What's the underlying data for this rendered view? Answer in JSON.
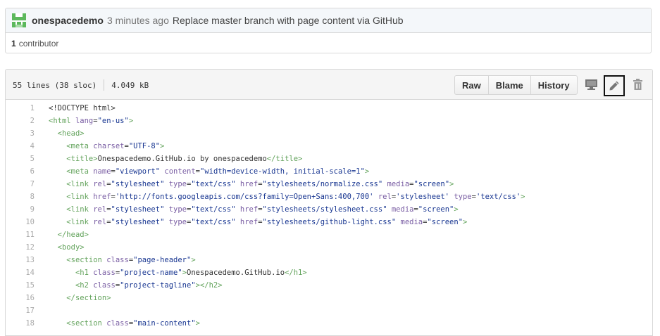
{
  "commit": {
    "author": "onespacedemo",
    "time_ago": "3 minutes ago",
    "message": "Replace master branch with page content via GitHub",
    "contributors_count": "1",
    "contributors_label": "contributor"
  },
  "file": {
    "lines_info": "55 lines (38 sloc)",
    "size": "4.049 kB",
    "buttons": {
      "raw": "Raw",
      "blame": "Blame",
      "history": "History"
    },
    "icons": [
      "desktop-icon",
      "pencil-icon",
      "trash-icon"
    ]
  },
  "colors": {
    "tag": "#63a35c",
    "attr": "#795da3",
    "string": "#183691",
    "avatar": "#5cb85c"
  },
  "code_lines": [
    {
      "n": "1",
      "tokens": [
        [
          "txt",
          "<!DOCTYPE html>"
        ]
      ]
    },
    {
      "n": "2",
      "tokens": [
        [
          "tag",
          "<html "
        ],
        [
          "attr",
          "lang"
        ],
        [
          "txt",
          "="
        ],
        [
          "str",
          "\"en-us\""
        ],
        [
          "tag",
          ">"
        ]
      ]
    },
    {
      "n": "3",
      "tokens": [
        [
          "txt",
          "  "
        ],
        [
          "tag",
          "<head>"
        ]
      ]
    },
    {
      "n": "4",
      "tokens": [
        [
          "txt",
          "    "
        ],
        [
          "tag",
          "<meta "
        ],
        [
          "attr",
          "charset"
        ],
        [
          "txt",
          "="
        ],
        [
          "str",
          "\"UTF-8\""
        ],
        [
          "tag",
          ">"
        ]
      ]
    },
    {
      "n": "5",
      "tokens": [
        [
          "txt",
          "    "
        ],
        [
          "tag",
          "<title>"
        ],
        [
          "txt",
          "Onespacedemo.GitHub.io by onespacedemo"
        ],
        [
          "tag",
          "</title>"
        ]
      ]
    },
    {
      "n": "6",
      "tokens": [
        [
          "txt",
          "    "
        ],
        [
          "tag",
          "<meta "
        ],
        [
          "attr",
          "name"
        ],
        [
          "txt",
          "="
        ],
        [
          "str",
          "\"viewport\""
        ],
        [
          "txt",
          " "
        ],
        [
          "attr",
          "content"
        ],
        [
          "txt",
          "="
        ],
        [
          "str",
          "\"width=device-width, initial-scale=1\""
        ],
        [
          "tag",
          ">"
        ]
      ]
    },
    {
      "n": "7",
      "tokens": [
        [
          "txt",
          "    "
        ],
        [
          "tag",
          "<link "
        ],
        [
          "attr",
          "rel"
        ],
        [
          "txt",
          "="
        ],
        [
          "str",
          "\"stylesheet\""
        ],
        [
          "txt",
          " "
        ],
        [
          "attr",
          "type"
        ],
        [
          "txt",
          "="
        ],
        [
          "str",
          "\"text/css\""
        ],
        [
          "txt",
          " "
        ],
        [
          "attr",
          "href"
        ],
        [
          "txt",
          "="
        ],
        [
          "str",
          "\"stylesheets/normalize.css\""
        ],
        [
          "txt",
          " "
        ],
        [
          "attr",
          "media"
        ],
        [
          "txt",
          "="
        ],
        [
          "str",
          "\"screen\""
        ],
        [
          "tag",
          ">"
        ]
      ]
    },
    {
      "n": "8",
      "tokens": [
        [
          "txt",
          "    "
        ],
        [
          "tag",
          "<link "
        ],
        [
          "attr",
          "href"
        ],
        [
          "txt",
          "="
        ],
        [
          "str",
          "'http://fonts.googleapis.com/css?family=Open+Sans:400,700'"
        ],
        [
          "txt",
          " "
        ],
        [
          "attr",
          "rel"
        ],
        [
          "txt",
          "="
        ],
        [
          "str",
          "'stylesheet'"
        ],
        [
          "txt",
          " "
        ],
        [
          "attr",
          "type"
        ],
        [
          "txt",
          "="
        ],
        [
          "str",
          "'text/css'"
        ],
        [
          "tag",
          ">"
        ]
      ]
    },
    {
      "n": "9",
      "tokens": [
        [
          "txt",
          "    "
        ],
        [
          "tag",
          "<link "
        ],
        [
          "attr",
          "rel"
        ],
        [
          "txt",
          "="
        ],
        [
          "str",
          "\"stylesheet\""
        ],
        [
          "txt",
          " "
        ],
        [
          "attr",
          "type"
        ],
        [
          "txt",
          "="
        ],
        [
          "str",
          "\"text/css\""
        ],
        [
          "txt",
          " "
        ],
        [
          "attr",
          "href"
        ],
        [
          "txt",
          "="
        ],
        [
          "str",
          "\"stylesheets/stylesheet.css\""
        ],
        [
          "txt",
          " "
        ],
        [
          "attr",
          "media"
        ],
        [
          "txt",
          "="
        ],
        [
          "str",
          "\"screen\""
        ],
        [
          "tag",
          ">"
        ]
      ]
    },
    {
      "n": "10",
      "tokens": [
        [
          "txt",
          "    "
        ],
        [
          "tag",
          "<link "
        ],
        [
          "attr",
          "rel"
        ],
        [
          "txt",
          "="
        ],
        [
          "str",
          "\"stylesheet\""
        ],
        [
          "txt",
          " "
        ],
        [
          "attr",
          "type"
        ],
        [
          "txt",
          "="
        ],
        [
          "str",
          "\"text/css\""
        ],
        [
          "txt",
          " "
        ],
        [
          "attr",
          "href"
        ],
        [
          "txt",
          "="
        ],
        [
          "str",
          "\"stylesheets/github-light.css\""
        ],
        [
          "txt",
          " "
        ],
        [
          "attr",
          "media"
        ],
        [
          "txt",
          "="
        ],
        [
          "str",
          "\"screen\""
        ],
        [
          "tag",
          ">"
        ]
      ]
    },
    {
      "n": "11",
      "tokens": [
        [
          "txt",
          "  "
        ],
        [
          "tag",
          "</head>"
        ]
      ]
    },
    {
      "n": "12",
      "tokens": [
        [
          "txt",
          "  "
        ],
        [
          "tag",
          "<body>"
        ]
      ]
    },
    {
      "n": "13",
      "tokens": [
        [
          "txt",
          "    "
        ],
        [
          "tag",
          "<section "
        ],
        [
          "attr",
          "class"
        ],
        [
          "txt",
          "="
        ],
        [
          "str",
          "\"page-header\""
        ],
        [
          "tag",
          ">"
        ]
      ]
    },
    {
      "n": "14",
      "tokens": [
        [
          "txt",
          "      "
        ],
        [
          "tag",
          "<h1 "
        ],
        [
          "attr",
          "class"
        ],
        [
          "txt",
          "="
        ],
        [
          "str",
          "\"project-name\""
        ],
        [
          "tag",
          ">"
        ],
        [
          "txt",
          "Onespacedemo.GitHub.io"
        ],
        [
          "tag",
          "</h1>"
        ]
      ]
    },
    {
      "n": "15",
      "tokens": [
        [
          "txt",
          "      "
        ],
        [
          "tag",
          "<h2 "
        ],
        [
          "attr",
          "class"
        ],
        [
          "txt",
          "="
        ],
        [
          "str",
          "\"project-tagline\""
        ],
        [
          "tag",
          "></h2>"
        ]
      ]
    },
    {
      "n": "16",
      "tokens": [
        [
          "txt",
          "    "
        ],
        [
          "tag",
          "</section>"
        ]
      ]
    },
    {
      "n": "17",
      "tokens": []
    },
    {
      "n": "18",
      "tokens": [
        [
          "txt",
          "    "
        ],
        [
          "tag",
          "<section "
        ],
        [
          "attr",
          "class"
        ],
        [
          "txt",
          "="
        ],
        [
          "str",
          "\"main-content\""
        ],
        [
          "tag",
          ">"
        ]
      ]
    }
  ]
}
